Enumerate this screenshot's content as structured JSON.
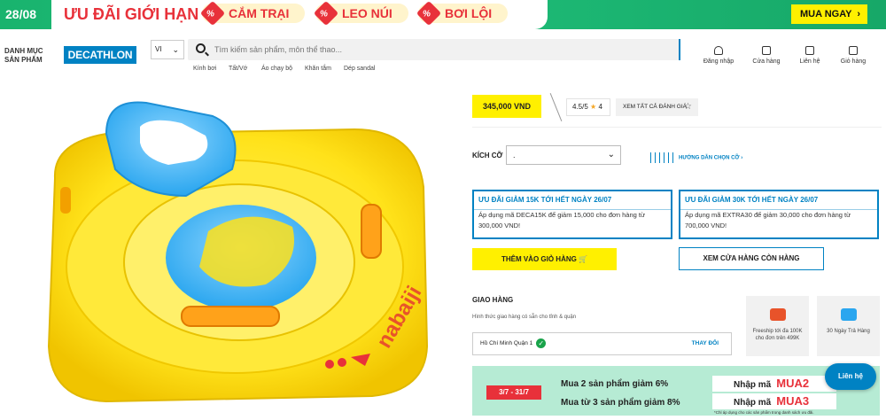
{
  "promo": {
    "date": "28/08",
    "title": "ƯU ĐÃI GIỚI HẠN",
    "tags": [
      "CẮM TRẠI",
      "LEO NÚI",
      "BƠI LỘI"
    ],
    "cta": "MUA NGAY",
    "colors": {
      "green": "#19b36e",
      "red": "#e8313a",
      "yellow": "#fff000"
    }
  },
  "header": {
    "menu_line1": "DANH MỤC",
    "menu_line2": "SẢN PHẨM",
    "logo": "DECATHLON",
    "language": "VI",
    "search_placeholder": "Tìm kiếm sản phẩm, môn thể thao...",
    "suggestions": [
      "Kính bơi",
      "Tất/Vớ",
      "Áo chạy bộ",
      "Khăn tắm",
      "Dép sandal"
    ],
    "actions": [
      {
        "label": "Đăng nhập",
        "icon": "user-icon"
      },
      {
        "label": "Cửa hàng",
        "icon": "store-icon"
      },
      {
        "label": "Liên hệ",
        "icon": "chat-icon"
      },
      {
        "label": "Giỏ hàng",
        "icon": "cart-icon"
      }
    ],
    "brand_color": "#0082c3"
  },
  "product": {
    "brand_mark": "nabaiji",
    "price": "345,000 VND",
    "rating": "4.5/5",
    "rating_count": "4",
    "all_reviews": "XEM TẤT CẢ ĐÁNH GIÁ",
    "size_label": "KÍCH CỠ",
    "size_value": ".",
    "size_guide": "HƯỚNG DẪN CHỌN CỠ",
    "offers": [
      {
        "title": "ƯU ĐÃI GIẢM 15K TỚI HẾT NGÀY 26/07",
        "desc": "Áp dụng mã DECA15K để giảm 15,000 cho đơn hàng từ 300,000 VND!"
      },
      {
        "title": "ƯU ĐÃI GIẢM 30K TỚI HẾT NGÀY 26/07",
        "desc": "Áp dụng mã EXTRA30 để giảm 30,000 cho đơn hàng từ 700,000 VND!"
      }
    ],
    "add_to_cart": "THÊM VÀO GIỎ HÀNG",
    "view_store": "XEM CỬA HÀNG CÒN HÀNG"
  },
  "shipping": {
    "label": "GIAO HÀNG",
    "desc": "Hình thức giao hàng có sẵn cho tỉnh & quận",
    "location": "Hồ Chí Minh Quận 1",
    "change": "THAY ĐỔI",
    "services": [
      {
        "line1": "Freeship tới đa 100K",
        "line2": "cho đơn trên 499K",
        "icon": "truck-icon"
      },
      {
        "line1": "30 Ngày Trả Hàng",
        "line2": "",
        "icon": "return-icon"
      }
    ]
  },
  "bottom_promo": {
    "dates": "3/7 - 31/7",
    "line1": "Mua 2 sản phẩm giảm 6%",
    "line2": "Mua từ 3 sản phẩm giảm 8%",
    "code_prefix": "Nhập mã",
    "code1": "MUA2",
    "code2": "MUA3",
    "fine_print": "*Chỉ áp dụng cho các sản phẩm trong danh sách ưu đãi."
  },
  "chat_button": "Liên hệ"
}
